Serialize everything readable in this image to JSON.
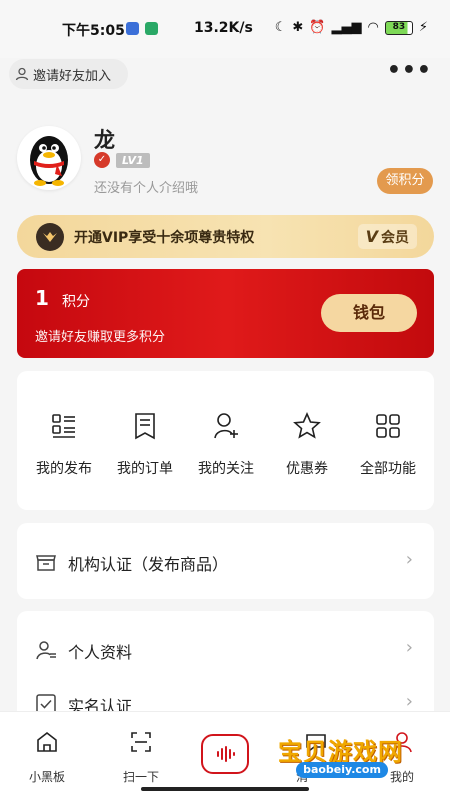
{
  "status_bar": {
    "time": "下午5:05",
    "net_speed": "13.2K/s",
    "battery": "83"
  },
  "header": {
    "invite_label": "邀请好友加入",
    "more_icon": "more-dots-icon"
  },
  "profile": {
    "name": "龙",
    "level": "LV1",
    "intro": "还没有个人介绍哦",
    "points_button": "领积分"
  },
  "vip": {
    "text": "开通VIP享受十余项尊贵特权",
    "tag": "会员"
  },
  "points_card": {
    "value": "1",
    "unit": "积分",
    "subtitle": "邀请好友赚取更多积分",
    "wallet_label": "钱包"
  },
  "functions": [
    {
      "label": "我的发布",
      "icon": "list-icon"
    },
    {
      "label": "我的订单",
      "icon": "order-icon"
    },
    {
      "label": "我的关注",
      "icon": "follow-user-icon"
    },
    {
      "label": "优惠券",
      "icon": "star-icon"
    },
    {
      "label": "全部功能",
      "icon": "grid-icon"
    }
  ],
  "list_items": [
    {
      "label": "机构认证（发布商品）",
      "icon": "store-icon"
    },
    {
      "label": "个人资料",
      "icon": "profile-icon"
    },
    {
      "label": "实名认证",
      "icon": "checkbox-icon"
    }
  ],
  "tabs": [
    {
      "label": "小黑板",
      "icon": "home-icon"
    },
    {
      "label": "扫一下",
      "icon": "scan-icon"
    },
    {
      "label": "",
      "icon": "voice-icon"
    },
    {
      "label": "消",
      "icon": "message-icon"
    },
    {
      "label": "我的",
      "icon": "user-icon"
    }
  ],
  "watermark": {
    "title": "宝贝游戏网",
    "url": "baobeiy.com"
  },
  "colors": {
    "primary_red": "#d1141b",
    "gold": "#f3d79b",
    "points_orange": "#e39a4e"
  }
}
